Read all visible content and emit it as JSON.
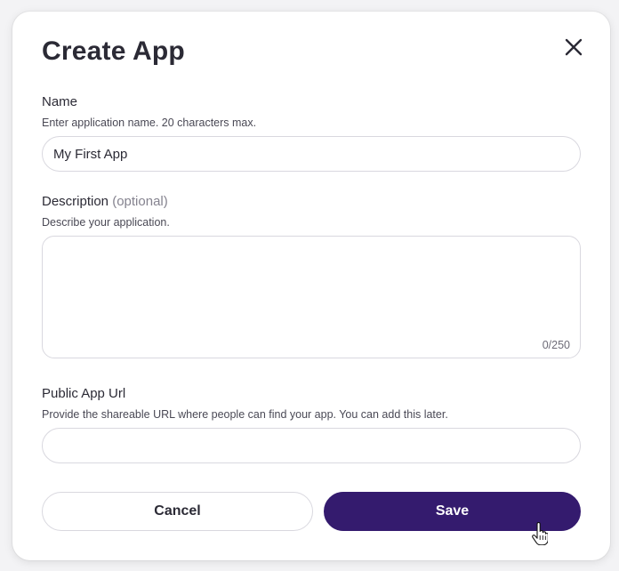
{
  "dialog": {
    "title": "Create App",
    "close_icon": "close-icon"
  },
  "fields": {
    "name": {
      "label": "Name",
      "hint": "Enter application name. 20 characters max.",
      "value": "My First App",
      "placeholder": ""
    },
    "description": {
      "label": "Description",
      "optional": "(optional)",
      "hint": "Describe your application.",
      "value": "",
      "counter": "0/250"
    },
    "public_url": {
      "label": "Public App Url",
      "hint": "Provide the shareable URL where people can find your app. You can add this later.",
      "value": ""
    }
  },
  "actions": {
    "cancel_label": "Cancel",
    "save_label": "Save"
  },
  "colors": {
    "primary": "#341b6e",
    "text": "#2b2a35",
    "border": "#d9d8df"
  },
  "cursor_icon": "hand-pointer-icon"
}
